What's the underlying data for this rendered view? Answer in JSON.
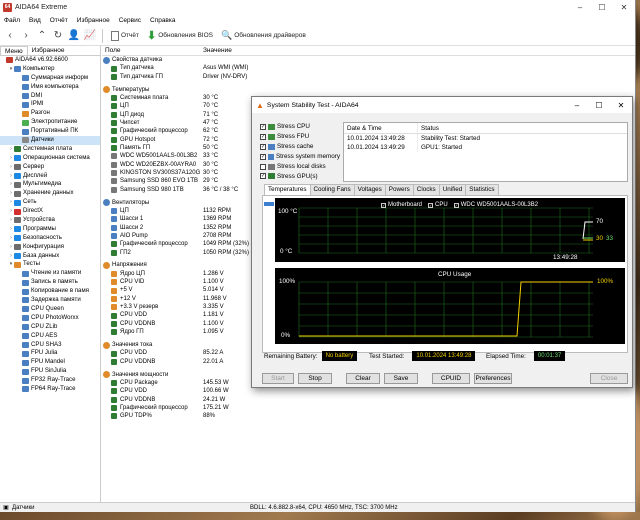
{
  "main": {
    "title": "AIDA64 Extreme",
    "menu": [
      "Файл",
      "Вид",
      "Отчёт",
      "Избранное",
      "Сервис",
      "Справка"
    ],
    "toolbar": {
      "report": "Отчёт",
      "bios_update": "Обновления BIOS",
      "driver_update": "Обновления драйверов"
    },
    "tabs": [
      "Меню",
      "Избранное"
    ],
    "tree": [
      {
        "label": "AIDA64 v6.92.6600",
        "level": 0,
        "exp": "",
        "icon": "#c0392b"
      },
      {
        "label": "Компьютер",
        "level": 1,
        "exp": "v",
        "icon": "#4a7fc1"
      },
      {
        "label": "Суммарная информ",
        "level": 2,
        "exp": "",
        "icon": "#4a7fc1"
      },
      {
        "label": "Имя компьютера",
        "level": 2,
        "exp": "",
        "icon": "#4a7fc1"
      },
      {
        "label": "DMI",
        "level": 2,
        "exp": "",
        "icon": "#4a7fc1"
      },
      {
        "label": "IPMI",
        "level": 2,
        "exp": "",
        "icon": "#4a7fc1"
      },
      {
        "label": "Разгон",
        "level": 2,
        "exp": "",
        "icon": "#e08a2a"
      },
      {
        "label": "Электропитание",
        "level": 2,
        "exp": "",
        "icon": "#4caf50"
      },
      {
        "label": "Портативный ПК",
        "level": 2,
        "exp": "",
        "icon": "#4a7fc1"
      },
      {
        "label": "Датчики",
        "level": 2,
        "exp": "",
        "icon": "#888888"
      },
      {
        "label": "Системная плата",
        "level": 1,
        "exp": ">",
        "icon": "#2e7d32"
      },
      {
        "label": "Операционная система",
        "level": 1,
        "exp": ">",
        "icon": "#1e88e5"
      },
      {
        "label": "Сервер",
        "level": 1,
        "exp": ">",
        "icon": "#6d6d6d"
      },
      {
        "label": "Дисплей",
        "level": 1,
        "exp": ">",
        "icon": "#1e88e5"
      },
      {
        "label": "Мультимедиа",
        "level": 1,
        "exp": ">",
        "icon": "#6d6d6d"
      },
      {
        "label": "Хранение данных",
        "level": 1,
        "exp": ">",
        "icon": "#6d6d6d"
      },
      {
        "label": "Сеть",
        "level": 1,
        "exp": ">",
        "icon": "#1e88e5"
      },
      {
        "label": "DirectX",
        "level": 1,
        "exp": ">",
        "icon": "#d32f2f"
      },
      {
        "label": "Устройства",
        "level": 1,
        "exp": ">",
        "icon": "#6d6d6d"
      },
      {
        "label": "Программы",
        "level": 1,
        "exp": ">",
        "icon": "#1e88e5"
      },
      {
        "label": "Безопасность",
        "level": 1,
        "exp": ">",
        "icon": "#1e88e5"
      },
      {
        "label": "Конфигурация",
        "level": 1,
        "exp": ">",
        "icon": "#6d6d6d"
      },
      {
        "label": "База данных",
        "level": 1,
        "exp": ">",
        "icon": "#1e88e5"
      },
      {
        "label": "Тесты",
        "level": 1,
        "exp": "v",
        "icon": "#e08a2a"
      },
      {
        "label": "Чтение из памяти",
        "level": 2,
        "exp": "",
        "icon": "#4a7fc1"
      },
      {
        "label": "Запись в память",
        "level": 2,
        "exp": "",
        "icon": "#4a7fc1"
      },
      {
        "label": "Копирование в памя",
        "level": 2,
        "exp": "",
        "icon": "#4a7fc1"
      },
      {
        "label": "Задержка памяти",
        "level": 2,
        "exp": "",
        "icon": "#4a7fc1"
      },
      {
        "label": "CPU Queen",
        "level": 2,
        "exp": "",
        "icon": "#4a7fc1"
      },
      {
        "label": "CPU PhotoWorxx",
        "level": 2,
        "exp": "",
        "icon": "#4a7fc1"
      },
      {
        "label": "CPU ZLib",
        "level": 2,
        "exp": "",
        "icon": "#4a7fc1"
      },
      {
        "label": "CPU AES",
        "level": 2,
        "exp": "",
        "icon": "#4a7fc1"
      },
      {
        "label": "CPU SHA3",
        "level": 2,
        "exp": "",
        "icon": "#4a7fc1"
      },
      {
        "label": "FPU Julia",
        "level": 2,
        "exp": "",
        "icon": "#4a7fc1"
      },
      {
        "label": "FPU Mandel",
        "level": 2,
        "exp": "",
        "icon": "#4a7fc1"
      },
      {
        "label": "FPU SinJulia",
        "level": 2,
        "exp": "",
        "icon": "#4a7fc1"
      },
      {
        "label": "FP32 Ray-Trace",
        "level": 2,
        "exp": "",
        "icon": "#4a7fc1"
      },
      {
        "label": "FP64 Ray-Trace",
        "level": 2,
        "exp": "",
        "icon": "#4a7fc1"
      }
    ],
    "columns": [
      "Поле",
      "Значение"
    ],
    "rows": [
      {
        "type": "sec",
        "f": "Свойства датчика",
        "v": "",
        "icon": "#4a7fc1"
      },
      {
        "f": "Тип датчика",
        "v": "Asus WMI  (WMI)",
        "icon": "#2e7d32"
      },
      {
        "f": "Тип датчика ГП",
        "v": "Driver  (NV-DRV)",
        "icon": "#2e7d32"
      },
      {
        "type": "gap"
      },
      {
        "type": "sec",
        "f": "Температуры",
        "v": "",
        "icon": "#e08a2a"
      },
      {
        "f": "Системная плата",
        "v": "30 °C",
        "icon": "#2e7d32"
      },
      {
        "f": "ЦП",
        "v": "70 °C",
        "icon": "#2e7d32"
      },
      {
        "f": "ЦП диод",
        "v": "71 °C",
        "icon": "#2e7d32"
      },
      {
        "f": "Чипсет",
        "v": "47 °C",
        "icon": "#2e7d32"
      },
      {
        "f": "Графический процессор",
        "v": "62 °C",
        "icon": "#2e7d32"
      },
      {
        "f": "GPU Hotspot",
        "v": "72 °C",
        "icon": "#2e7d32"
      },
      {
        "f": "Память ГП",
        "v": "50 °C",
        "icon": "#2e7d32"
      },
      {
        "f": "WDC WD5001AALS-00L3B2",
        "v": "33 °C",
        "icon": "#777777"
      },
      {
        "f": "WDC WD20EZBX-00AYRA0",
        "v": "30 °C",
        "icon": "#777777"
      },
      {
        "f": "KINGSTON SV300S37A120G",
        "v": "30 °C",
        "icon": "#777777"
      },
      {
        "f": "Samsung SSD 860 EVO 1TB",
        "v": "29 °C",
        "icon": "#777777"
      },
      {
        "f": "Samsung SSD 980 1TB",
        "v": "36 °C / 38 °C",
        "icon": "#777777"
      },
      {
        "type": "gap"
      },
      {
        "type": "sec",
        "f": "Вентиляторы",
        "v": "",
        "icon": "#4a7fc1"
      },
      {
        "f": "ЦП",
        "v": "1132 RPM",
        "icon": "#4a7fc1"
      },
      {
        "f": "Шасси 1",
        "v": "1369 RPM",
        "icon": "#4a7fc1"
      },
      {
        "f": "Шасси 2",
        "v": "1352 RPM",
        "icon": "#4a7fc1"
      },
      {
        "f": "AIO Pump",
        "v": "2708 RPM",
        "icon": "#4a7fc1"
      },
      {
        "f": "Графический процессор",
        "v": "1049 RPM  (32%)",
        "icon": "#2e7d32"
      },
      {
        "f": "ГП2",
        "v": "1050 RPM  (32%)",
        "icon": "#2e7d32"
      },
      {
        "type": "gap"
      },
      {
        "type": "sec",
        "f": "Напряжения",
        "v": "",
        "icon": "#e08a2a"
      },
      {
        "f": "Ядро ЦП",
        "v": "1.286 V",
        "icon": "#e08a2a"
      },
      {
        "f": "CPU VID",
        "v": "1.100 V",
        "icon": "#e08a2a"
      },
      {
        "f": "+5 V",
        "v": "5.014 V",
        "icon": "#e08a2a"
      },
      {
        "f": "+12 V",
        "v": "11.968 V",
        "icon": "#e08a2a"
      },
      {
        "f": "+3.3 V резерв",
        "v": "3.335 V",
        "icon": "#e08a2a"
      },
      {
        "f": "CPU VDD",
        "v": "1.181 V",
        "icon": "#2e7d32"
      },
      {
        "f": "CPU VDDNB",
        "v": "1.100 V",
        "icon": "#2e7d32"
      },
      {
        "f": "Ядро ГП",
        "v": "1.095 V",
        "icon": "#2e7d32"
      },
      {
        "type": "gap"
      },
      {
        "type": "sec",
        "f": "Значения тока",
        "v": "",
        "icon": "#e08a2a"
      },
      {
        "f": "CPU VDD",
        "v": "85.22 A",
        "icon": "#2e7d32"
      },
      {
        "f": "CPU VDDNB",
        "v": "22.01 A",
        "icon": "#2e7d32"
      },
      {
        "type": "gap"
      },
      {
        "type": "sec",
        "f": "Значения мощности",
        "v": "",
        "icon": "#e08a2a"
      },
      {
        "f": "CPU Package",
        "v": "145.53 W",
        "icon": "#2e7d32"
      },
      {
        "f": "CPU VDD",
        "v": "100.66 W",
        "icon": "#2e7d32"
      },
      {
        "f": "CPU VDDNB",
        "v": "24.21 W",
        "icon": "#2e7d32"
      },
      {
        "f": "Графический процессор",
        "v": "175.21 W",
        "icon": "#2e7d32"
      },
      {
        "f": "GPU TDP%",
        "v": "88%",
        "icon": "#2e7d32"
      }
    ],
    "status_left": "Датчики",
    "status_right": "BDLL: 4.6.882.8-x64, CPU: 4650 MHz, TSC: 3700 MHz"
  },
  "dialog": {
    "title": "System Stability Test - AIDA64",
    "checks": [
      {
        "label": "Stress CPU",
        "checked": true
      },
      {
        "label": "Stress FPU",
        "checked": true
      },
      {
        "label": "Stress cache",
        "checked": true
      },
      {
        "label": "Stress system memory",
        "checked": true
      },
      {
        "label": "Stress local disks",
        "checked": false
      },
      {
        "label": "Stress GPU(s)",
        "checked": true
      }
    ],
    "log_columns": [
      "Date & Time",
      "Status"
    ],
    "log": [
      {
        "time": "10.01.2024 13:49:28",
        "status": "Stability Test: Started"
      },
      {
        "time": "10.01.2024 13:49:29",
        "status": "GPU1: Started"
      }
    ],
    "tabs": [
      "Temperatures",
      "Cooling Fans",
      "Voltages",
      "Powers",
      "Clocks",
      "Unified",
      "Statistics"
    ],
    "temp_graph": {
      "legend": [
        "Motherboard",
        "CPU",
        "WDC WD5001AALS-00L3B2"
      ],
      "y_top": "100 °C",
      "y_bottom": "0 °C",
      "time": "13:49:28",
      "value_cpu": "70",
      "value_mb": "30",
      "value_disk": "33",
      "colors": {
        "cpu": "#ffffff",
        "mb": "#f5d000",
        "disk": "#6fe06f"
      }
    },
    "usage_graph": {
      "title": "CPU Usage",
      "y_top": "100%",
      "y_bottom": "0%",
      "value": "100%",
      "color": "#f5d000"
    },
    "battery_label": "Remaining Battery:",
    "battery_value": "No battery",
    "started_label": "Test Started:",
    "started_value": "10.01.2024 13:49:28",
    "elapsed_label": "Elapsed Time:",
    "elapsed_value": "00:01:37",
    "buttons": {
      "start": "Start",
      "stop": "Stop",
      "clear": "Clear",
      "save": "Save",
      "cpuid": "CPUID",
      "prefs": "Preferences",
      "close": "Close"
    }
  }
}
